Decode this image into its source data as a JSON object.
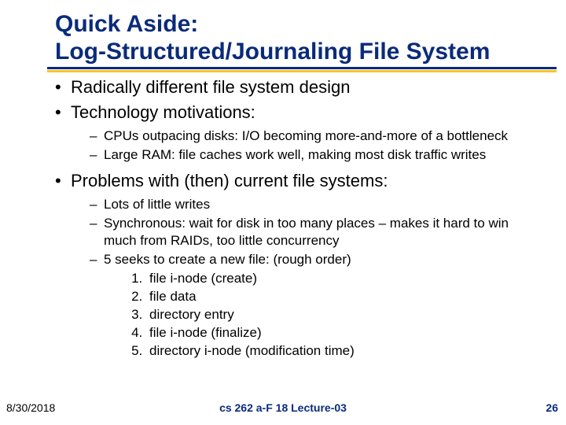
{
  "title": {
    "line1": "Quick Aside:",
    "line2": "Log-Structured/Journaling File System"
  },
  "bullets": {
    "b1": "Radically different file system design",
    "b2": "Technology motivations:",
    "b2_sub": {
      "s1": "CPUs outpacing disks: I/O becoming more-and-more of a bottleneck",
      "s2": "Large RAM: file caches work well, making most disk traffic writes"
    },
    "b3": "Problems with (then) current file systems:",
    "b3_sub": {
      "s1": "Lots of little writes",
      "s2": "Synchronous: wait for disk in too many places – makes it hard to win much from RAIDs, too little concurrency",
      "s3": "5 seeks to create a new file: (rough order)",
      "s3_list": {
        "i1": "file i-node (create)",
        "i2": "file data",
        "i3": "directory entry",
        "i4": "file i-node (finalize)",
        "i5": "directory i-node (modification time)"
      }
    }
  },
  "footer": {
    "date": "8/30/2018",
    "center": "cs 262 a-F 18 Lecture-03",
    "page": "26"
  }
}
